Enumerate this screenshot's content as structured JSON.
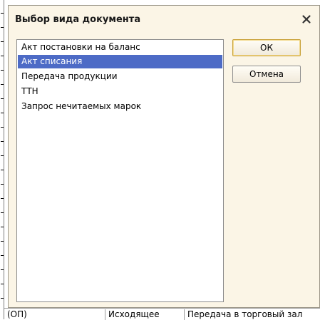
{
  "dialog": {
    "title": "Выбор вида документа",
    "items": [
      {
        "label": "Акт постановки на баланс",
        "selected": false
      },
      {
        "label": "Акт списания",
        "selected": true
      },
      {
        "label": "Передача продукции",
        "selected": false
      },
      {
        "label": "ТТН",
        "selected": false
      },
      {
        "label": "Запрос нечитаемых марок",
        "selected": false
      }
    ],
    "ok_label": "ОК",
    "cancel_label": "Отмена"
  },
  "background_row": {
    "cells": [
      "(ОП)",
      "Исходящее",
      "Передача в торговый зал"
    ]
  },
  "colors": {
    "dialog_bg": "#fbf5e6",
    "selection": "#4d6bc6"
  },
  "icons": {
    "close": "close-icon"
  }
}
